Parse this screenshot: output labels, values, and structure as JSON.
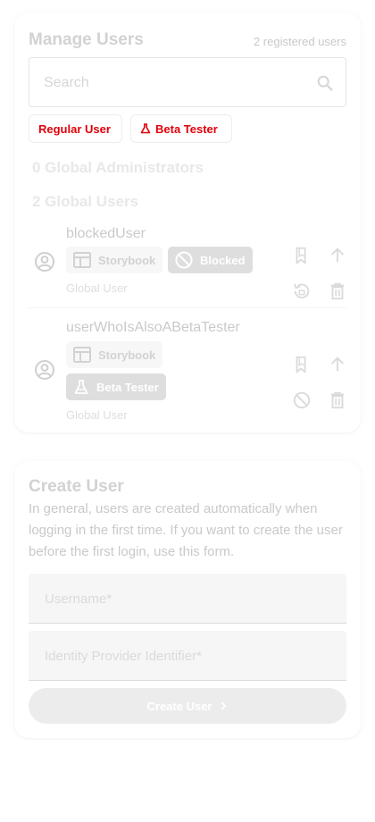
{
  "manage": {
    "title": "Manage Users",
    "registered_count": "2 registered users",
    "search_placeholder": "Search",
    "filters": [
      {
        "label": "Regular User"
      },
      {
        "label": "Beta Tester"
      }
    ],
    "admins_heading": "0 Global Administrators",
    "users_heading": "2 Global Users",
    "users": [
      {
        "name": "blockedUser",
        "tags": [
          "Storybook",
          "Blocked"
        ],
        "role": "Global User"
      },
      {
        "name": "userWhoIsAlsoABetaTester",
        "tags": [
          "Storybook",
          "Beta Tester"
        ],
        "role": "Global User"
      }
    ]
  },
  "create": {
    "title": "Create User",
    "description": "In general, users are created automatically when logging in the first time. If you want to create the user before the first login, use this form.",
    "username_placeholder": "Username*",
    "idp_placeholder": "Identity Provider Identifier*",
    "button_label": "Create User"
  },
  "colors": {
    "accent_red": "#e0000a",
    "muted_text": "#d2d2d2",
    "tag_dark": "#dedede"
  }
}
